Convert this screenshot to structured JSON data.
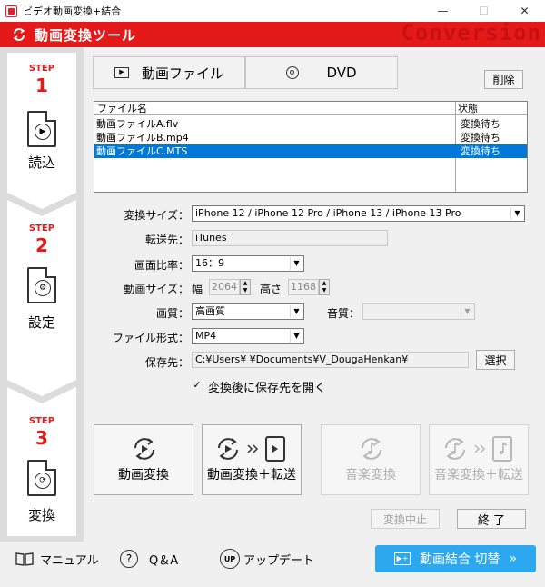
{
  "window": {
    "title": "ビデオ動画変換+結合",
    "minimize": "—",
    "maximize": "☐",
    "close": "✕"
  },
  "header": {
    "title": "動画変換ツール",
    "watermark": "Conversion"
  },
  "steps": [
    {
      "label": "STEP",
      "num": "1",
      "caption": "読込"
    },
    {
      "label": "STEP",
      "num": "2",
      "caption": "設定"
    },
    {
      "label": "STEP",
      "num": "3",
      "caption": "変換"
    }
  ],
  "source_buttons": {
    "video": "動画ファイル",
    "dvd": "DVD",
    "delete": "削除"
  },
  "file_list": {
    "headers": [
      "ファイル名",
      "状態"
    ],
    "rows": [
      {
        "name": "動画ファイルA.flv",
        "status": "変換待ち"
      },
      {
        "name": "動画ファイルB.mp4",
        "status": "変換待ち"
      },
      {
        "name": "動画ファイルC.MTS",
        "status": "変換待ち"
      }
    ],
    "selected_index": 2
  },
  "settings": {
    "convert_size_label": "変換サイズ：",
    "convert_size_value": "iPhone 12 / iPhone 12 Pro / iPhone 13 / iPhone 13 Pro",
    "destination_label": "転送先：",
    "destination_value": "iTunes",
    "aspect_label": "画面比率：",
    "aspect_value": "16：9",
    "video_size_label": "動画サイズ：",
    "width_label": "幅",
    "width_value": "2064",
    "height_label": "高さ",
    "height_value": "1168",
    "quality_label": "画質：",
    "quality_value": "高画質",
    "audio_label": "音質：",
    "audio_value": "",
    "format_label": "ファイル形式：",
    "format_value": "MP4",
    "save_label": "保存先：",
    "save_value": "C:¥Users¥       ¥Documents¥V_DougaHenkan¥",
    "select_button": "選択",
    "open_after_label": "変換後に保存先を開く",
    "open_after_checked": true
  },
  "actions": {
    "convert": "動画変換",
    "convert_transfer": "動画変換＋転送",
    "music": "音楽変換",
    "music_transfer": "音楽変換＋転送",
    "stop": "変換中止",
    "finish": "終 了"
  },
  "footer": {
    "manual": "マニュアル",
    "qa": "Q＆A",
    "update": "アップデート",
    "merge": "動画結合 切替"
  },
  "colors": {
    "accent_red": "#e41a1a",
    "selection_blue": "#0078d7",
    "merge_blue": "#2ba8f0"
  }
}
